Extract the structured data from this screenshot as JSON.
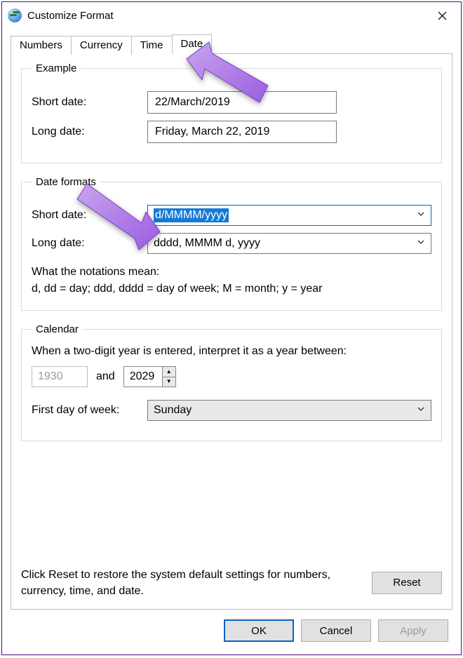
{
  "window": {
    "title": "Customize Format"
  },
  "tabs": [
    {
      "label": "Numbers",
      "active": false
    },
    {
      "label": "Currency",
      "active": false
    },
    {
      "label": "Time",
      "active": false
    },
    {
      "label": "Date",
      "active": true
    }
  ],
  "example_group": {
    "legend": "Example",
    "short_date_label": "Short date:",
    "short_date_value": "22/March/2019",
    "long_date_label": "Long date:",
    "long_date_value": "Friday, March 22, 2019"
  },
  "formats_group": {
    "legend": "Date formats",
    "short_date_label": "Short date:",
    "short_date_value": "d/MMMM/yyyy",
    "long_date_label": "Long date:",
    "long_date_value": "dddd, MMMM d, yyyy",
    "notation_heading": "What the notations mean:",
    "notation_body": "d, dd = day;  ddd, dddd = day of week;  M = month;  y = year"
  },
  "calendar_group": {
    "legend": "Calendar",
    "two_digit_text": "When a two-digit year is entered, interpret it as a year between:",
    "year_from": "1930",
    "and_label": "and",
    "year_to": "2029",
    "first_day_label": "First day of week:",
    "first_day_value": "Sunday"
  },
  "footer": {
    "reset_text": "Click Reset to restore the system default settings for numbers, currency, time, and date.",
    "reset_btn": "Reset",
    "ok": "OK",
    "cancel": "Cancel",
    "apply": "Apply"
  }
}
